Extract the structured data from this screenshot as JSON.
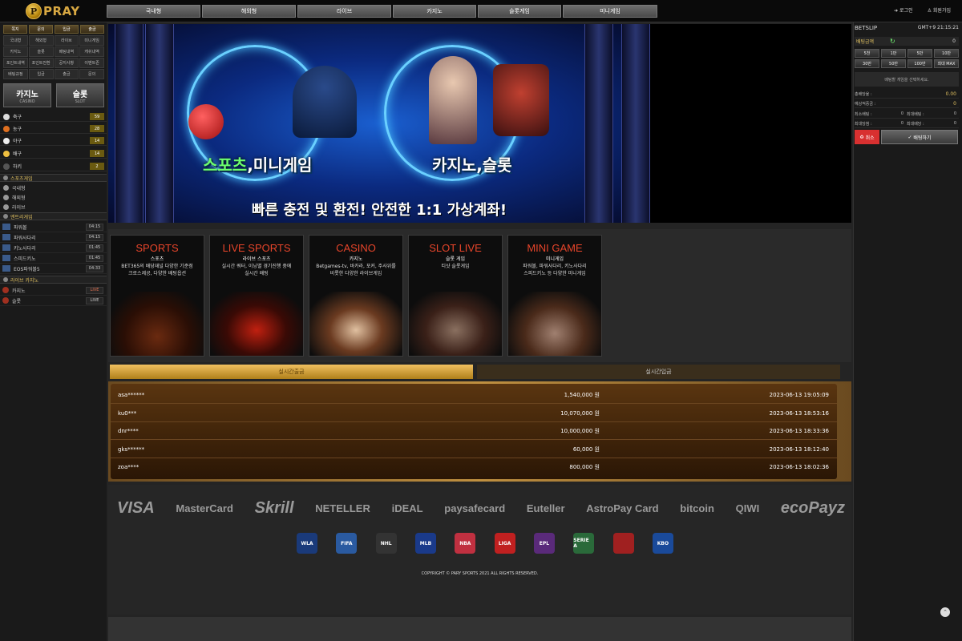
{
  "header": {
    "logo_letter": "P",
    "logo_text": "PRAY",
    "nav": [
      "국내형",
      "해외형",
      "라이브",
      "카지노",
      "슬롯게임",
      "미니게임"
    ],
    "login": "로그인",
    "signup": "회원가입"
  },
  "sidebar": {
    "quick": [
      "쪽지",
      "문의",
      "입금",
      "출금"
    ],
    "menu": [
      "국내형",
      "해외형",
      "라이브",
      "미니게임",
      "카지노",
      "슬롯",
      "배팅내역",
      "캐쉬내역",
      "포인트내역",
      "포인트전환",
      "공지사항",
      "이벤트존",
      "배팅규정",
      "입금",
      "출금",
      "문의"
    ],
    "casino_tab": {
      "k": "카지노",
      "e": "CASINO"
    },
    "slot_tab": {
      "k": "슬롯",
      "e": "SLOT"
    },
    "sports": [
      {
        "label": "축구",
        "count": "59",
        "color": "#ddd"
      },
      {
        "label": "농구",
        "count": "28",
        "color": "#e07020"
      },
      {
        "label": "야구",
        "count": "14",
        "color": "#eee"
      },
      {
        "label": "배구",
        "count": "14",
        "color": "#f0c040"
      },
      {
        "label": "하키",
        "count": "2",
        "color": "#444"
      }
    ],
    "section_sports": "스포츠게임",
    "sports_sub": [
      "국내형",
      "해외형",
      "라이브"
    ],
    "section_ent": "엔트리게임",
    "minigames": [
      {
        "label": "파워볼",
        "time": "04:15"
      },
      {
        "label": "파워사다리",
        "time": "04:15"
      },
      {
        "label": "키노사다리",
        "time": "01:45"
      },
      {
        "label": "스피드키노",
        "time": "01:45"
      },
      {
        "label": "EOS파워볼5",
        "time": "04:33"
      }
    ],
    "section_live": "라이브 카지노",
    "live": [
      {
        "label": "카지노",
        "tag": "LIVE"
      },
      {
        "label": "슬롯",
        "tag": "LIVE"
      }
    ]
  },
  "banner": {
    "left_caption_a": "스포츠",
    "left_caption_b": ",미니게임",
    "right_caption": "카지노,슬롯",
    "tagline": "빠른 충전 및 환전! 안전한 1:1 가상계좌!"
  },
  "cards": [
    {
      "title": "SPORTS",
      "sub": "스포츠",
      "desc": "BET365의 배당재널 다양한 기준점\n크로스제공, 다양한 배팅옵션"
    },
    {
      "title": "LIVE SPORTS",
      "sub": "라이브 스포츠",
      "desc": "실시간 쿼터, 이닝별 경기진행 중에\n실시간 배팅"
    },
    {
      "title": "CASINO",
      "sub": "카지노",
      "desc": "Betgames-tv, 바카라, 포커, 주사위를\n비롯한 다양한 라이브게임"
    },
    {
      "title": "SLOT LIVE",
      "sub": "슬롯 게임",
      "desc": "티샷 슬롯게임"
    },
    {
      "title": "MINI GAME",
      "sub": "미니게임",
      "desc": "파워볼, 파워사다리, 키노사다리\n스피드키노 등 다양한 미니게임"
    }
  ],
  "tabs": {
    "withdraw": "실시간출금",
    "deposit": "실시간입금"
  },
  "withdrawals": [
    {
      "user": "asa******",
      "amount": "1,540,000",
      "unit": "원",
      "date": "2023-06-13 19:05:09"
    },
    {
      "user": "ku0***",
      "amount": "10,070,000",
      "unit": "원",
      "date": "2023-06-13 18:53:16"
    },
    {
      "user": "dnr****",
      "amount": "10,000,000",
      "unit": "원",
      "date": "2023-06-13 18:33:36"
    },
    {
      "user": "gks******",
      "amount": "60,000",
      "unit": "원",
      "date": "2023-06-13 18:12:40"
    },
    {
      "user": "zoa****",
      "amount": "800,000",
      "unit": "원",
      "date": "2023-06-13 18:02:36"
    }
  ],
  "payments": [
    "VISA",
    "MasterCard",
    "Skrill",
    "NETELLER",
    "iDEAL",
    "paysafecard",
    "Euteller",
    "AstroPay Card",
    "bitcoin",
    "QIWI",
    "ecoPayz"
  ],
  "leagues": [
    "WLA",
    "FIFA",
    "NHL",
    "MLB",
    "NBA",
    "LIGA",
    "EPL",
    "SERIE A",
    "",
    "KBO"
  ],
  "copyright": "COPYRIGHT © PARY SPORTS 2021 ALL RIGHTS RESERVED.",
  "betslip": {
    "title": "BETSLIP",
    "clock": "GMT+9 21:15:21",
    "amount_label": "배팅금액",
    "amount_value": "0",
    "chips": [
      "5천",
      "1만",
      "5만",
      "10만",
      "30만",
      "50만",
      "100만",
      "최대 MAX"
    ],
    "message": "배팅할 게임을 선택하세요.",
    "total_odds_label": "총배당율 :",
    "total_odds": "0.00",
    "expected_label": "예상적중금 :",
    "expected": "0",
    "min_bet_label": "최소배팅 :",
    "min_bet": "0",
    "max_bet_label": "최대배팅 :",
    "max_bet": "0",
    "max_win_label": "최대당첨 :",
    "max_win": "0",
    "max_odds_label": "최대배당 :",
    "max_odds": "0",
    "cancel": "취소",
    "bet": "배팅하기"
  }
}
